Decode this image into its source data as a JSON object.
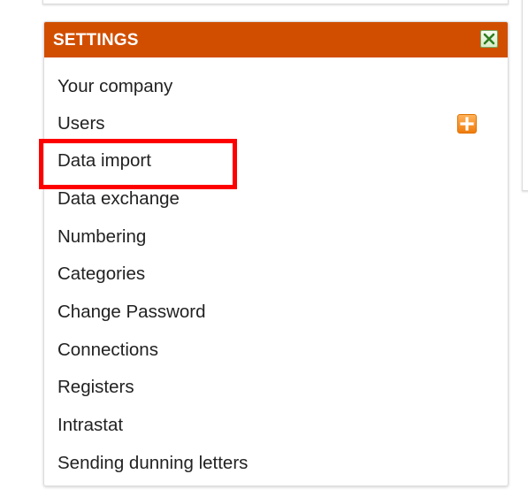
{
  "settings_panel": {
    "title": "SETTINGS",
    "close_icon": "close-icon",
    "add_icon": "plus-icon",
    "header_color": "#d14e00",
    "items": [
      {
        "label": "Your company"
      },
      {
        "label": "Users"
      },
      {
        "label": "Data import"
      },
      {
        "label": "Data exchange"
      },
      {
        "label": "Numbering"
      },
      {
        "label": "Categories"
      },
      {
        "label": "Change Password"
      },
      {
        "label": "Connections"
      },
      {
        "label": "Registers"
      },
      {
        "label": "Intrastat"
      },
      {
        "label": "Sending dunning letters"
      }
    ]
  },
  "annotation": {
    "highlight_color": "#ff0000",
    "highlighted_item": "Data import"
  }
}
